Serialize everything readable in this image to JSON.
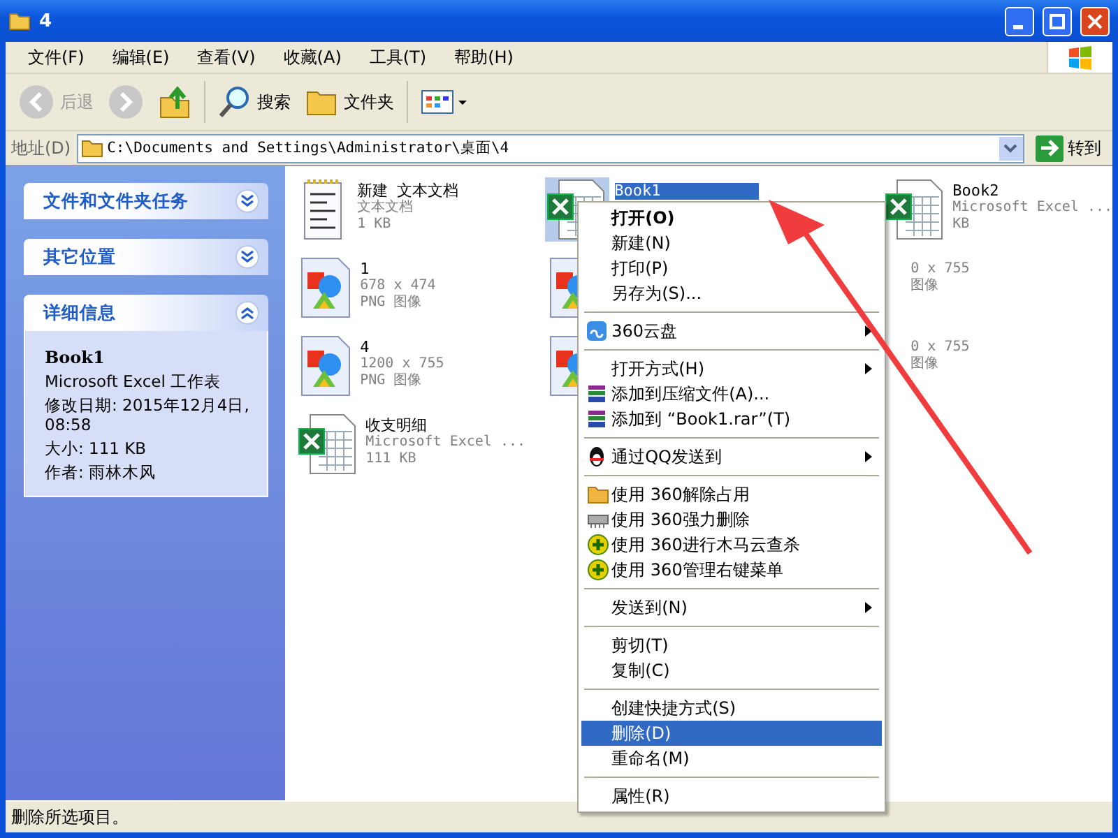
{
  "window": {
    "title": "4"
  },
  "menu_bar": [
    "文件(F)",
    "编辑(E)",
    "查看(V)",
    "收藏(A)",
    "工具(T)",
    "帮助(H)"
  ],
  "toolbar": {
    "back": {
      "label": "后退",
      "disabled": true
    },
    "search": "搜索",
    "folders": "文件夹"
  },
  "address": {
    "label": "地址(D)",
    "value": "C:\\Documents and Settings\\Administrator\\桌面\\4",
    "go": "转到"
  },
  "task_pane": [
    {
      "title": "文件和文件夹任务",
      "expanded": false
    },
    {
      "title": "其它位置",
      "expanded": false
    },
    {
      "title": "详细信息",
      "expanded": true,
      "name": "Book1",
      "lines": [
        "Microsoft Excel 工作表",
        "修改日期: 2015年12月4日, 08:58",
        "大小: 111 KB",
        "作者: 雨林木风"
      ]
    }
  ],
  "files": [
    {
      "kind": "text",
      "name": "新建 文本文档",
      "lines": [
        "文本文档",
        "1 KB"
      ],
      "selected": false
    },
    {
      "kind": "excel",
      "name": "Book1",
      "selected": true
    },
    {
      "kind": "excel",
      "name": "Book2",
      "lines": [
        "Microsoft Excel ...",
        "KB"
      ],
      "selected": false
    },
    {
      "kind": "png",
      "name": "1",
      "lines": [
        "678 x 474",
        "PNG 图像"
      ],
      "selected": false
    },
    {
      "kind": "png",
      "selected": false
    },
    {
      "kind": "none",
      "lines": [
        "0 x 755",
        "图像"
      ],
      "selected": false
    },
    {
      "kind": "png",
      "name": "4",
      "lines": [
        "1200 x 755",
        "PNG 图像"
      ],
      "selected": false
    },
    {
      "kind": "png",
      "selected": false
    },
    {
      "kind": "none",
      "lines": [
        "0 x 755",
        "图像"
      ],
      "selected": false
    },
    {
      "kind": "excel",
      "name": "收支明细",
      "lines": [
        "Microsoft Excel ...",
        "111 KB"
      ],
      "selected": false
    }
  ],
  "context_menu": [
    {
      "kind": "item",
      "label": "打开(O)",
      "bold": true,
      "submenu": false,
      "selected": false
    },
    {
      "kind": "item",
      "label": "新建(N)",
      "bold": false,
      "submenu": false,
      "selected": false
    },
    {
      "kind": "item",
      "label": "打印(P)",
      "bold": false,
      "submenu": false,
      "selected": false
    },
    {
      "kind": "item",
      "label": "另存为(S)...",
      "bold": false,
      "submenu": false,
      "selected": false
    },
    {
      "kind": "separator"
    },
    {
      "kind": "item",
      "label": "360云盘",
      "bold": false,
      "submenu": true,
      "selected": false
    },
    {
      "kind": "separator"
    },
    {
      "kind": "item",
      "label": "打开方式(H)",
      "bold": false,
      "submenu": true,
      "selected": false
    },
    {
      "kind": "item",
      "label": "添加到压缩文件(A)...",
      "bold": false,
      "submenu": false,
      "selected": false
    },
    {
      "kind": "item",
      "label": "添加到 “Book1.rar”(T)",
      "bold": false,
      "submenu": false,
      "selected": false
    },
    {
      "kind": "separator"
    },
    {
      "kind": "item",
      "label": "通过QQ发送到",
      "bold": false,
      "submenu": true,
      "selected": false
    },
    {
      "kind": "separator"
    },
    {
      "kind": "item",
      "label": "使用 360解除占用",
      "bold": false,
      "submenu": false,
      "selected": false
    },
    {
      "kind": "item",
      "label": "使用 360强力删除",
      "bold": false,
      "submenu": false,
      "selected": false
    },
    {
      "kind": "item",
      "label": "使用 360进行木马云查杀",
      "bold": false,
      "submenu": false,
      "selected": false
    },
    {
      "kind": "item",
      "label": "使用 360管理右键菜单",
      "bold": false,
      "submenu": false,
      "selected": false
    },
    {
      "kind": "separator"
    },
    {
      "kind": "item",
      "label": "发送到(N)",
      "bold": false,
      "submenu": true,
      "selected": false
    },
    {
      "kind": "separator"
    },
    {
      "kind": "item",
      "label": "剪切(T)",
      "bold": false,
      "submenu": false,
      "selected": false
    },
    {
      "kind": "item",
      "label": "复制(C)",
      "bold": false,
      "submenu": false,
      "selected": false
    },
    {
      "kind": "separator"
    },
    {
      "kind": "item",
      "label": "创建快捷方式(S)",
      "bold": false,
      "submenu": false,
      "selected": false
    },
    {
      "kind": "item",
      "label": "删除(D)",
      "bold": false,
      "submenu": false,
      "selected": true
    },
    {
      "kind": "item",
      "label": "重命名(M)",
      "bold": false,
      "submenu": false,
      "selected": false
    },
    {
      "kind": "separator"
    },
    {
      "kind": "item",
      "label": "属性(R)",
      "bold": false,
      "submenu": false,
      "selected": false
    }
  ],
  "status_bar": "删除所选项目。"
}
